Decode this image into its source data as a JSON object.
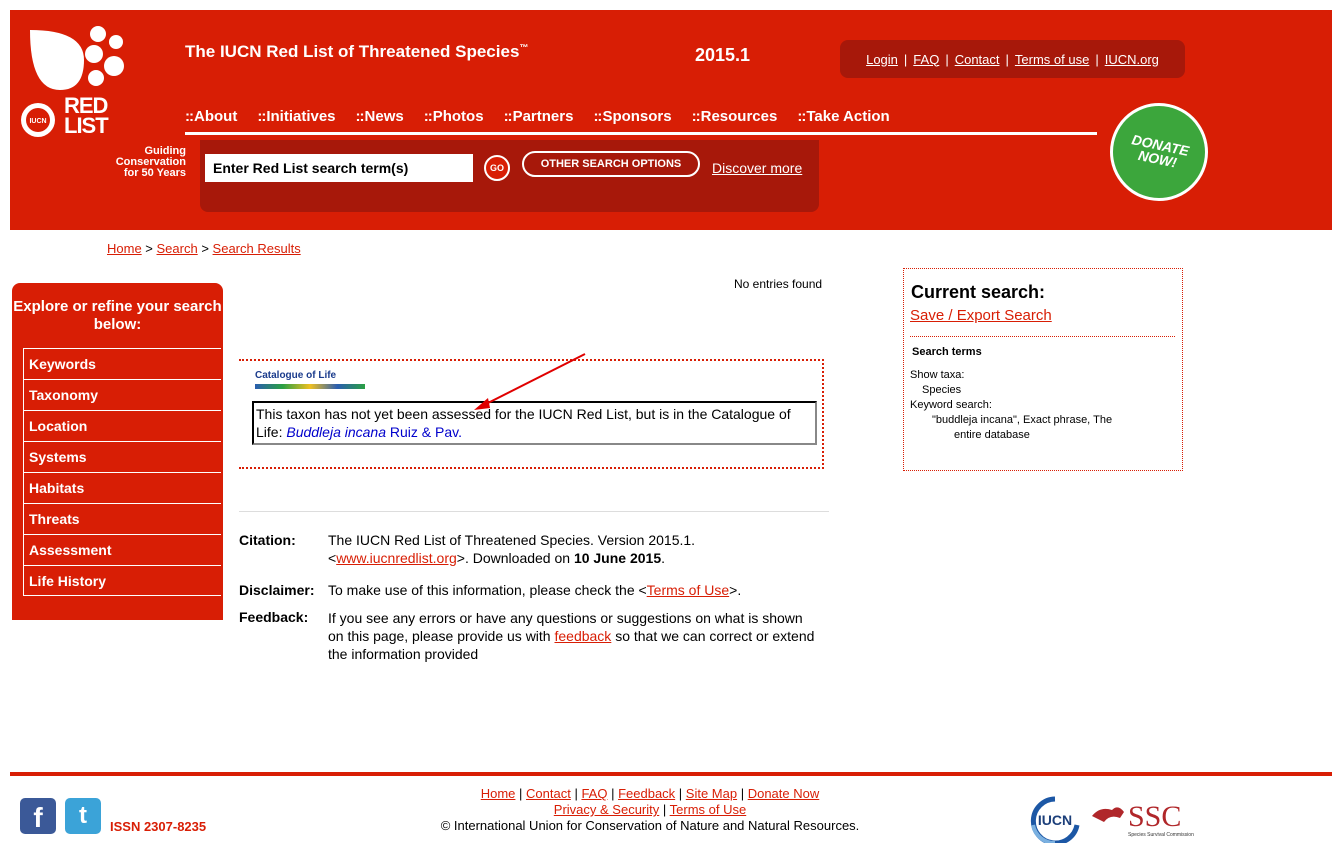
{
  "header": {
    "site_title": "The IUCN Red List of Threatened Species",
    "tm": "™",
    "version": "2015.1",
    "logo_red": "RED",
    "logo_list": "LIST",
    "logo_iucn": "IUCN",
    "tagline_1": "Guiding",
    "tagline_2": "Conservation",
    "tagline_3": "for 50 Years",
    "toplinks": [
      "Login",
      "FAQ",
      "Contact",
      "Terms of use",
      "IUCN.org"
    ],
    "nav": [
      "About",
      "Initiatives",
      "News",
      "Photos",
      "Partners",
      "Sponsors",
      "Resources",
      "Take Action"
    ],
    "nav_prefix": "::",
    "search_placeholder": "Enter Red List search term(s)",
    "go_label": "GO",
    "other_search_label": "OTHER SEARCH OPTIONS",
    "discover_label": "Discover more",
    "donate_1": "DONATE",
    "donate_2": "NOW!"
  },
  "breadcrumb": {
    "home": "Home",
    "sep": " > ",
    "search": "Search",
    "results": "Search Results"
  },
  "sidebar": {
    "title": "Explore or refine your search below:",
    "items": [
      "Keywords",
      "Taxonomy",
      "Location",
      "Systems",
      "Habitats",
      "Threats",
      "Assessment",
      "Life History"
    ]
  },
  "main": {
    "no_entries": "No entries found",
    "col_logo_text": "Catalogue of Life",
    "col_text_1": "This taxon has not yet been assessed for the IUCN Red List, but is in the Catalogue of Life: ",
    "col_species": "Buddleja incana",
    "col_author": " Ruiz & Pav.",
    "citation_label": "Citation:",
    "citation_1": "The IUCN Red List of Threatened Species. Version 2015.1.",
    "citation_lt": "<",
    "citation_link": "www.iucnredlist.org",
    "citation_2": ">. Downloaded on ",
    "citation_date": "10 June 2015",
    "citation_end": ".",
    "disclaimer_label": "Disclaimer:",
    "disclaimer_1": "To make use of this information, please check the <",
    "disclaimer_link": "Terms of Use",
    "disclaimer_2": ">.",
    "feedback_label": "Feedback:",
    "feedback_1": "If you see any errors or have any questions or suggestions on what is shown on this page, please provide us with ",
    "feedback_link": "feedback",
    "feedback_2": " so that we can correct or extend the information provided"
  },
  "current_search": {
    "title": "Current search:",
    "save_link": "Save / Export Search",
    "terms_heading": "Search terms",
    "show_taxa_label": "Show taxa:",
    "show_taxa_value": "Species",
    "keyword_label": "Keyword search:",
    "keyword_value_1": "\"buddleja incana\", Exact phrase, The",
    "keyword_value_2": "entire database"
  },
  "footer": {
    "links_row1": [
      "Home",
      "Contact",
      "FAQ",
      "Feedback",
      "Site Map",
      "Donate Now"
    ],
    "links_row2": [
      "Privacy & Security",
      "Terms of Use"
    ],
    "copyright": "© International Union for Conservation of Nature and Natural Resources.",
    "issn": "ISSN 2307-8235",
    "fb_glyph": "f",
    "tw_glyph": "t",
    "iucn_logo_text": "IUCN",
    "ssc_logo_text": "SSC",
    "ssc_sub": "Species Survival Commission"
  },
  "colors": {
    "brand_red": "#d81e05",
    "dark_red": "#a7180a",
    "donate_green": "#3ca63c"
  }
}
